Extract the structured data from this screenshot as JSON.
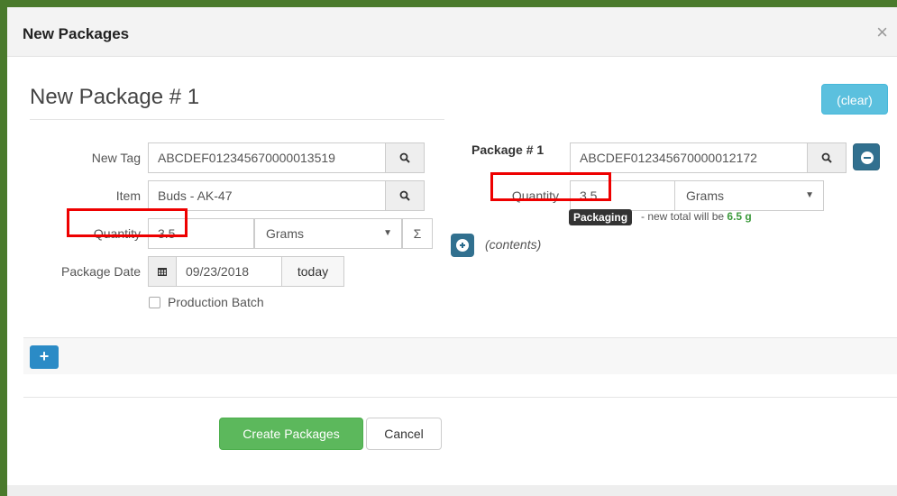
{
  "modal": {
    "title": "New Packages",
    "close_label": "×"
  },
  "left": {
    "heading": "New Package # 1",
    "new_tag": {
      "label": "New Tag",
      "value": "ABCDEF012345670000013519"
    },
    "item": {
      "label": "Item",
      "value": "Buds - AK-47"
    },
    "quantity": {
      "label": "Quantity",
      "value": "3.5",
      "unit": "Grams",
      "sum_symbol": "Σ"
    },
    "package_date": {
      "label": "Package Date",
      "value": "09/23/2018",
      "today_label": "today"
    },
    "production_batch_label": "Production Batch"
  },
  "clear_label": "(clear)",
  "right": {
    "package_label": "Package # 1",
    "tag_value": "ABCDEF012345670000012172",
    "quantity": {
      "label": "Quantity",
      "value": "3.5",
      "unit": "Grams"
    },
    "badge": "Packaging",
    "hint_text": "- new total will be",
    "hint_value": "6.5 g",
    "contents_label": "(contents)"
  },
  "add_label": "+",
  "footer": {
    "create_label": "Create Packages",
    "cancel_label": "Cancel"
  }
}
